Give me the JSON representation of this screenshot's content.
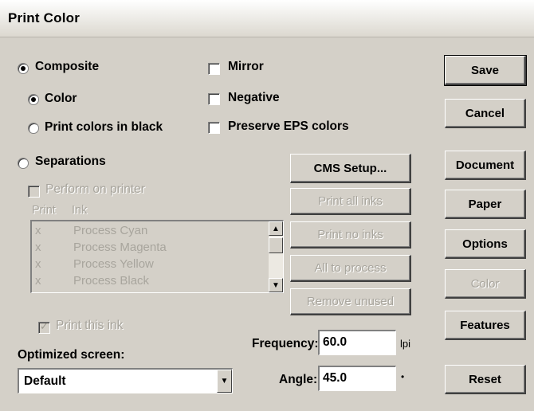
{
  "window": {
    "title": "Print Color"
  },
  "options": {
    "composite": "Composite",
    "color": "Color",
    "print_black": "Print colors in black",
    "separations": "Separations",
    "mirror": "Mirror",
    "negative": "Negative",
    "preserve_eps": "Preserve EPS colors",
    "perform_on_printer": "Perform on printer"
  },
  "ink_list": {
    "header_print": "Print",
    "header_ink": "Ink",
    "items": [
      {
        "print": "x",
        "ink": "Process Cyan"
      },
      {
        "print": "x",
        "ink": "Process Magenta"
      },
      {
        "print": "x",
        "ink": "Process Yellow"
      },
      {
        "print": "x",
        "ink": "Process Black"
      }
    ]
  },
  "ink_buttons": {
    "cms_setup": "CMS Setup...",
    "print_all_inks": "Print all inks",
    "print_no_inks": "Print no inks",
    "all_to_process": "All to process",
    "remove_unused": "Remove unused"
  },
  "print_this_ink": "Print this ink",
  "screen": {
    "label": "Optimized screen:",
    "selected": "Default"
  },
  "frequency": {
    "label": "Frequency:",
    "value": "60.0",
    "unit": "lpi"
  },
  "angle": {
    "label": "Angle:",
    "value": "45.0",
    "unit": "•"
  },
  "side_buttons": {
    "save": "Save",
    "cancel": "Cancel",
    "document": "Document",
    "paper": "Paper",
    "options": "Options",
    "color": "Color",
    "features": "Features",
    "reset": "Reset"
  }
}
